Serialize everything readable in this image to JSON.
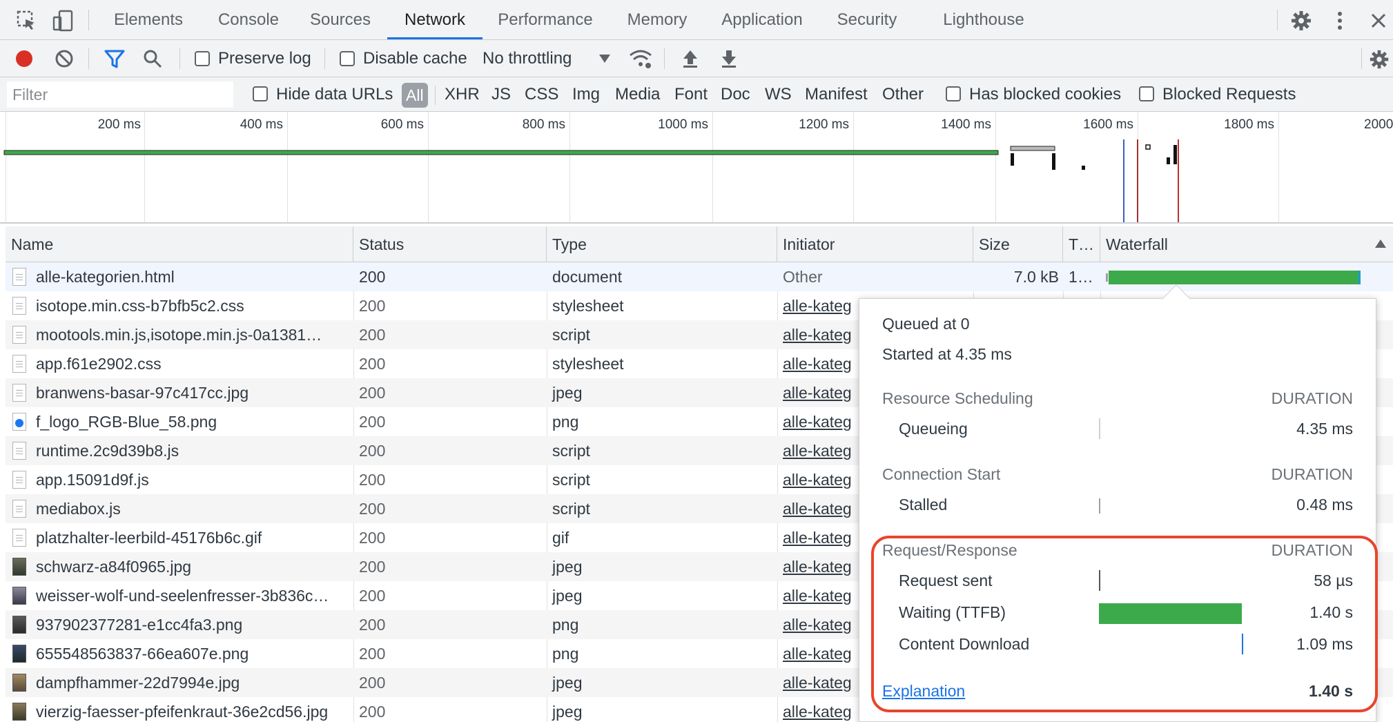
{
  "tabs": [
    {
      "label": "Elements"
    },
    {
      "label": "Console"
    },
    {
      "label": "Sources"
    },
    {
      "label": "Network"
    },
    {
      "label": "Performance"
    },
    {
      "label": "Memory"
    },
    {
      "label": "Application"
    },
    {
      "label": "Security"
    },
    {
      "label": "Lighthouse"
    }
  ],
  "active_tab": "Network",
  "toolbar": {
    "preserve_log": "Preserve log",
    "disable_cache": "Disable cache",
    "throttling": "No throttling"
  },
  "filterbar": {
    "placeholder": "Filter",
    "hide_data_urls": "Hide data URLs",
    "types": [
      "All",
      "XHR",
      "JS",
      "CSS",
      "Img",
      "Media",
      "Font",
      "Doc",
      "WS",
      "Manifest",
      "Other"
    ],
    "has_blocked_cookies": "Has blocked cookies",
    "blocked_requests": "Blocked Requests"
  },
  "overview": {
    "ticks": [
      "200 ms",
      "400 ms",
      "600 ms",
      "800 ms",
      "1000 ms",
      "1200 ms",
      "1400 ms",
      "1600 ms",
      "1800 ms",
      "2000"
    ]
  },
  "table": {
    "columns": [
      "Name",
      "Status",
      "Type",
      "Initiator",
      "Size",
      "T…",
      "Waterfall"
    ],
    "rows": [
      {
        "name": "alle-kategorien.html",
        "status": "200",
        "type": "document",
        "initiator": "Other",
        "size": "7.0 kB",
        "time": "1…",
        "icon": "document-icon"
      },
      {
        "name": "isotope.min.css-b7bfb5c2.css",
        "status": "200",
        "type": "stylesheet",
        "initiator": "alle-kateg",
        "icon": "document-icon"
      },
      {
        "name": "mootools.min.js,isotope.min.js-0a1381…",
        "status": "200",
        "type": "script",
        "initiator": "alle-kateg",
        "icon": "document-icon"
      },
      {
        "name": "app.f61e2902.css",
        "status": "200",
        "type": "stylesheet",
        "initiator": "alle-kateg",
        "icon": "document-icon"
      },
      {
        "name": "branwens-basar-97c417cc.jpg",
        "status": "200",
        "type": "jpeg",
        "initiator": "alle-kateg",
        "icon": "document-icon"
      },
      {
        "name": "f_logo_RGB-Blue_58.png",
        "status": "200",
        "type": "png",
        "initiator": "alle-kateg",
        "icon": "facebook-icon"
      },
      {
        "name": "runtime.2c9d39b8.js",
        "status": "200",
        "type": "script",
        "initiator": "alle-kateg",
        "icon": "document-icon"
      },
      {
        "name": "app.15091d9f.js",
        "status": "200",
        "type": "script",
        "initiator": "alle-kateg",
        "icon": "document-icon"
      },
      {
        "name": "mediabox.js",
        "status": "200",
        "type": "script",
        "initiator": "alle-kateg",
        "icon": "document-icon"
      },
      {
        "name": "platzhalter-leerbild-45176b6c.gif",
        "status": "200",
        "type": "gif",
        "initiator": "alle-kateg",
        "icon": "blank-image-icon"
      },
      {
        "name": "schwarz-a84f0965.jpg",
        "status": "200",
        "type": "jpeg",
        "initiator": "alle-kateg",
        "icon": "image-icon"
      },
      {
        "name": "weisser-wolf-und-seelenfresser-3b836c…",
        "status": "200",
        "type": "jpeg",
        "initiator": "alle-kateg",
        "icon": "image-icon"
      },
      {
        "name": "937902377281-e1cc4fa3.png",
        "status": "200",
        "type": "png",
        "initiator": "alle-kateg",
        "icon": "image-icon"
      },
      {
        "name": "655548563837-66ea607e.png",
        "status": "200",
        "type": "png",
        "initiator": "alle-kateg",
        "icon": "image-icon"
      },
      {
        "name": "dampfhammer-22d7994e.jpg",
        "status": "200",
        "type": "jpeg",
        "initiator": "alle-kateg",
        "icon": "image-icon"
      },
      {
        "name": "vierzig-faesser-pfeifenkraut-36e2cd56.jpg",
        "status": "200",
        "type": "jpeg",
        "initiator": "alle-kateg",
        "icon": "image-icon"
      }
    ]
  },
  "timing": {
    "queued_at": "Queued at 0",
    "started_at": "Started at 4.35 ms",
    "duration_label": "DURATION",
    "sections": [
      {
        "title": "Resource Scheduling",
        "items": [
          {
            "label": "Queueing",
            "value": "4.35 ms"
          }
        ]
      },
      {
        "title": "Connection Start",
        "items": [
          {
            "label": "Stalled",
            "value": "0.48 ms"
          }
        ]
      },
      {
        "title": "Request/Response",
        "items": [
          {
            "label": "Request sent",
            "value": "58 µs"
          },
          {
            "label": "Waiting (TTFB)",
            "value": "1.40 s"
          },
          {
            "label": "Content Download",
            "value": "1.09 ms"
          }
        ]
      }
    ],
    "explanation": "Explanation",
    "total": "1.40 s",
    "colors": {
      "waiting_bar": "#3caa4a",
      "highlight": "#e8452c"
    }
  }
}
